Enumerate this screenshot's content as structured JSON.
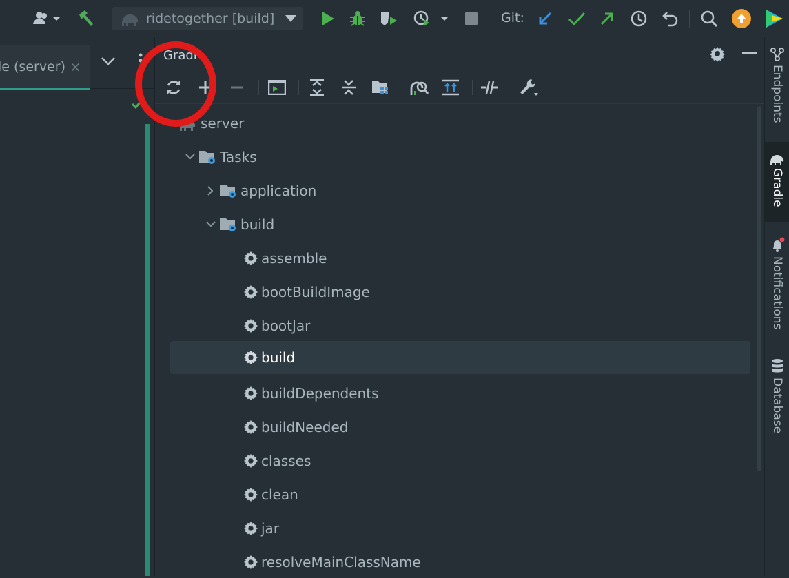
{
  "toolbar": {
    "run_config_label": "ridetogether [build]",
    "git_label": "Git:",
    "icons": [
      "account-icon",
      "build-hammer-icon",
      "elephant-icon",
      "dropdown-icon",
      "run-icon",
      "debug-icon",
      "coverage-icon",
      "profiler-icon",
      "stop-icon",
      "git-update-icon",
      "git-commit-icon",
      "git-push-icon",
      "history-icon",
      "revert-icon",
      "search-icon",
      "update-icon",
      "jetbrains-logo"
    ]
  },
  "editor": {
    "tab_label": "le (server)",
    "tab_close": "×"
  },
  "gradle": {
    "title": "Gradl",
    "tree": {
      "root": "server",
      "tasks_label": "Tasks",
      "groups": [
        {
          "label": "application",
          "expanded": false
        },
        {
          "label": "build",
          "expanded": true
        }
      ],
      "build_tasks": [
        "assemble",
        "bootBuildImage",
        "bootJar",
        "build",
        "buildDependents",
        "buildNeeded",
        "classes",
        "clean",
        "jar",
        "resolveMainClassName"
      ],
      "selected": "build"
    }
  },
  "right_stripe": {
    "items": [
      {
        "label": "Endpoints",
        "active": false
      },
      {
        "label": "Gradle",
        "active": true
      },
      {
        "label": "Notifications",
        "active": false
      },
      {
        "label": "Database",
        "active": false
      }
    ]
  },
  "colors": {
    "background": "#262f35",
    "accent_green": "#2e9e88",
    "run_green": "#4caf50",
    "git_blue": "#3d8fd8",
    "annotation_red": "#e11a1a",
    "update_orange": "#f0a030"
  }
}
